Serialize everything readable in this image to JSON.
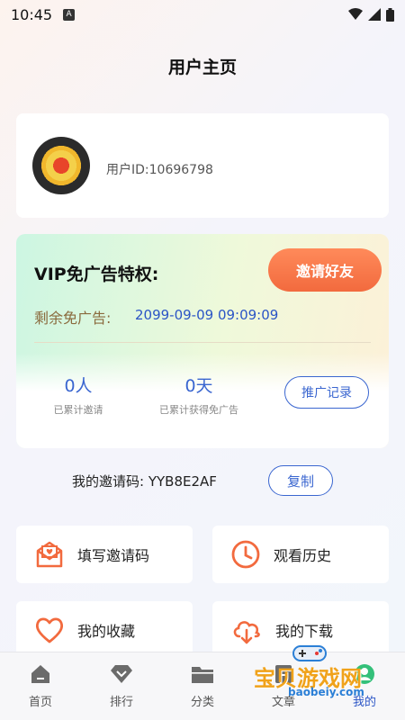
{
  "status_bar": {
    "time": "10:45",
    "a_icon": "A"
  },
  "page_title": "用户主页",
  "user": {
    "id_text": "用户ID:10696798"
  },
  "vip": {
    "title": "VIP免广告特权:",
    "invite_button": "邀请好友",
    "remain_label": "剩余免广告:",
    "remain_date": "2099-09-09 09:09:09",
    "invited_count": "0",
    "invited_unit": "人",
    "invited_label": "已累计邀请",
    "days_count": "0",
    "days_unit": "天",
    "days_label": "已累计获得免广告",
    "record_button": "推广记录"
  },
  "invite_code": {
    "label": "我的邀请码:  YYB8E2AF",
    "copy_button": "复制"
  },
  "menu": [
    {
      "label": "填写邀请码",
      "icon": "envelope-heart-icon",
      "color": "#f26a3e"
    },
    {
      "label": "观看历史",
      "icon": "clock-icon",
      "color": "#f26a3e"
    },
    {
      "label": "我的收藏",
      "icon": "heart-icon",
      "color": "#f26a3e"
    },
    {
      "label": "我的下载",
      "icon": "cloud-download-icon",
      "color": "#f26a3e"
    }
  ],
  "tabs": [
    {
      "label": "首页",
      "icon": "home-icon"
    },
    {
      "label": "排行",
      "icon": "diamond-icon"
    },
    {
      "label": "分类",
      "icon": "folder-icon"
    },
    {
      "label": "文章",
      "icon": "article-icon"
    },
    {
      "label": "我的",
      "icon": "user-icon",
      "active": true
    }
  ],
  "watermark": {
    "text": "宝贝游戏网",
    "url": "baobeiy.com"
  },
  "colors": {
    "accent": "#2b55c6",
    "orange": "#f26a3e"
  }
}
